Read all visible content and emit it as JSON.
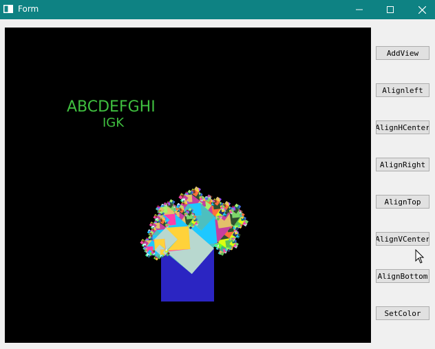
{
  "window": {
    "title": "Form",
    "icons": {
      "app": "window-icon",
      "minimize": "minimize-icon",
      "maximize": "maximize-icon",
      "close": "close-icon"
    },
    "titlebar_color": "#0e8283"
  },
  "canvas": {
    "text_line1": "ABCDEFGHI",
    "text_line2": "IGK",
    "text_color": "#3fbf3f",
    "background": "#000000"
  },
  "buttons": [
    {
      "id": "add-view",
      "label": "AddView"
    },
    {
      "id": "align-left",
      "label": "Alignleft"
    },
    {
      "id": "align-hcenter",
      "label": "AlignHCenter"
    },
    {
      "id": "align-right",
      "label": "AlignRight"
    },
    {
      "id": "align-top",
      "label": "AlignTop"
    },
    {
      "id": "align-vcenter",
      "label": "AlignVCenter"
    },
    {
      "id": "align-bottom",
      "label": "AlignBottom"
    },
    {
      "id": "set-color",
      "label": "SetColor"
    }
  ]
}
